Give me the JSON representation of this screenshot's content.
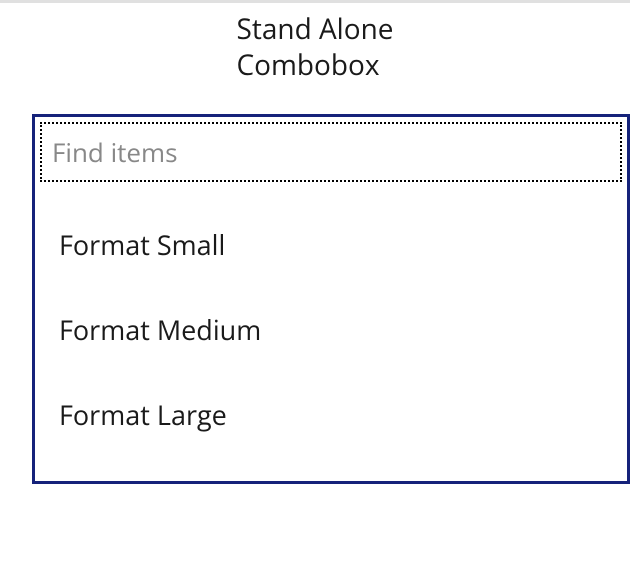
{
  "title": {
    "line1": "Stand Alone",
    "line2": "Combobox"
  },
  "search": {
    "placeholder": "Find items",
    "value": ""
  },
  "options": [
    {
      "label": "Format Small"
    },
    {
      "label": "Format Medium"
    },
    {
      "label": "Format Large"
    }
  ]
}
